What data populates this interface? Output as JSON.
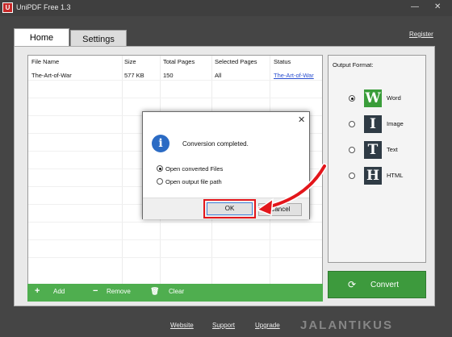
{
  "window": {
    "title": "UniPDF Free 1.3",
    "icon_letter": "U",
    "minimize_glyph": "—",
    "close_glyph": "✕"
  },
  "tabs": [
    {
      "label": "Home",
      "active": true
    },
    {
      "label": "Settings",
      "active": false
    }
  ],
  "register_link": "Register",
  "file_table": {
    "columns": [
      "File Name",
      "Size",
      "Total Pages",
      "Selected Pages",
      "Status"
    ],
    "rows": [
      {
        "file_name": "The-Art-of-War",
        "size": "577 KB",
        "total_pages": "150",
        "selected_pages": "All",
        "status": "The-Art-of-War"
      }
    ]
  },
  "bottom_bar": {
    "add": {
      "icon": "plus-icon",
      "glyph": "+",
      "label": "Add"
    },
    "remove": {
      "icon": "minus-icon",
      "glyph": "−",
      "label": "Remove"
    },
    "clear": {
      "icon": "trash-icon",
      "glyph": "🗑",
      "label": "Clear"
    }
  },
  "output": {
    "title": "Output Format:",
    "formats": [
      {
        "letter": "W",
        "label": "Word",
        "color": "#3a9d3a",
        "selected": true
      },
      {
        "letter": "I",
        "label": "Image",
        "color": "#2f3b45",
        "selected": false
      },
      {
        "letter": "T",
        "label": "Text",
        "color": "#2f3b45",
        "selected": false
      },
      {
        "letter": "H",
        "label": "HTML",
        "color": "#2f3b45",
        "selected": false
      }
    ]
  },
  "convert_button": {
    "label": "Convert",
    "icon": "refresh-icon",
    "glyph": "⟳"
  },
  "footer": {
    "website": "Website",
    "support": "Support",
    "upgrade": "Upgrade"
  },
  "watermark": "JALANTIKUS",
  "dialog": {
    "message": "Conversion completed.",
    "info_glyph": "i",
    "close_glyph": "✕",
    "options": [
      {
        "label": "Open converted Files",
        "selected": true
      },
      {
        "label": "Open output file path",
        "selected": false
      }
    ],
    "ok_label": "OK",
    "cancel_label": "Cancel"
  },
  "colors": {
    "accent_green": "#4fae4f",
    "highlight_red": "#e3161b",
    "link_blue": "#2a4fd0"
  }
}
